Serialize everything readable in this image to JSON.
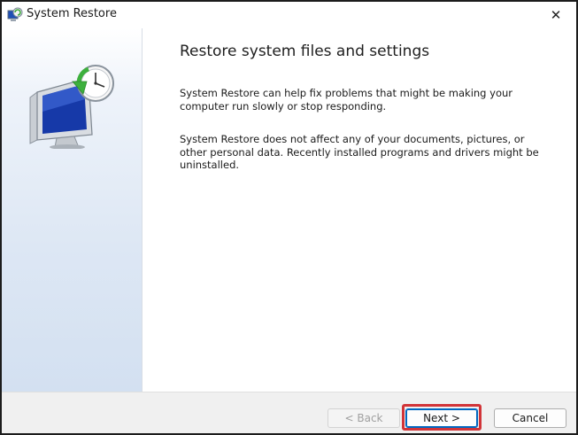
{
  "window": {
    "title": "System Restore",
    "close_glyph": "✕"
  },
  "icons": {
    "app": "system-restore-icon",
    "hero": "system-restore-monitor-clock-icon",
    "close": "close-icon"
  },
  "main": {
    "heading": "Restore system files and settings",
    "paragraph1": "System Restore can help fix problems that might be making your computer run slowly or stop responding.",
    "paragraph2": "System Restore does not affect any of your documents, pictures, or other personal data. Recently installed programs and drivers might be uninstalled."
  },
  "buttons": {
    "back": "< Back",
    "next": "Next >",
    "cancel": "Cancel"
  },
  "colors": {
    "highlight": "#d13438",
    "focus_border": "#0067c0",
    "sidebar_gradient_end": "#d3e0f1"
  },
  "state": {
    "back_enabled": false,
    "next_focused": true
  }
}
